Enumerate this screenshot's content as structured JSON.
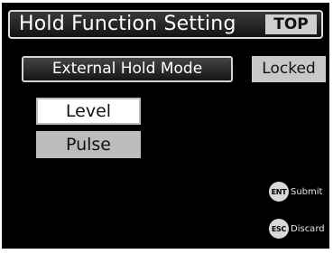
{
  "header": {
    "title": "Hold Function Setting",
    "top_button": "TOP"
  },
  "setting": {
    "label": "External Hold Mode",
    "value": "Locked"
  },
  "options": [
    {
      "label": "Level",
      "selected": true
    },
    {
      "label": "Pulse",
      "selected": false
    }
  ],
  "hints": {
    "submit": {
      "key": "ENT",
      "label": "Submit"
    },
    "discard": {
      "key": "ESC",
      "label": "Discard"
    }
  },
  "colors": {
    "background": "#000000",
    "highlight": "#ffffff",
    "inactive": "#bcbcbc"
  }
}
